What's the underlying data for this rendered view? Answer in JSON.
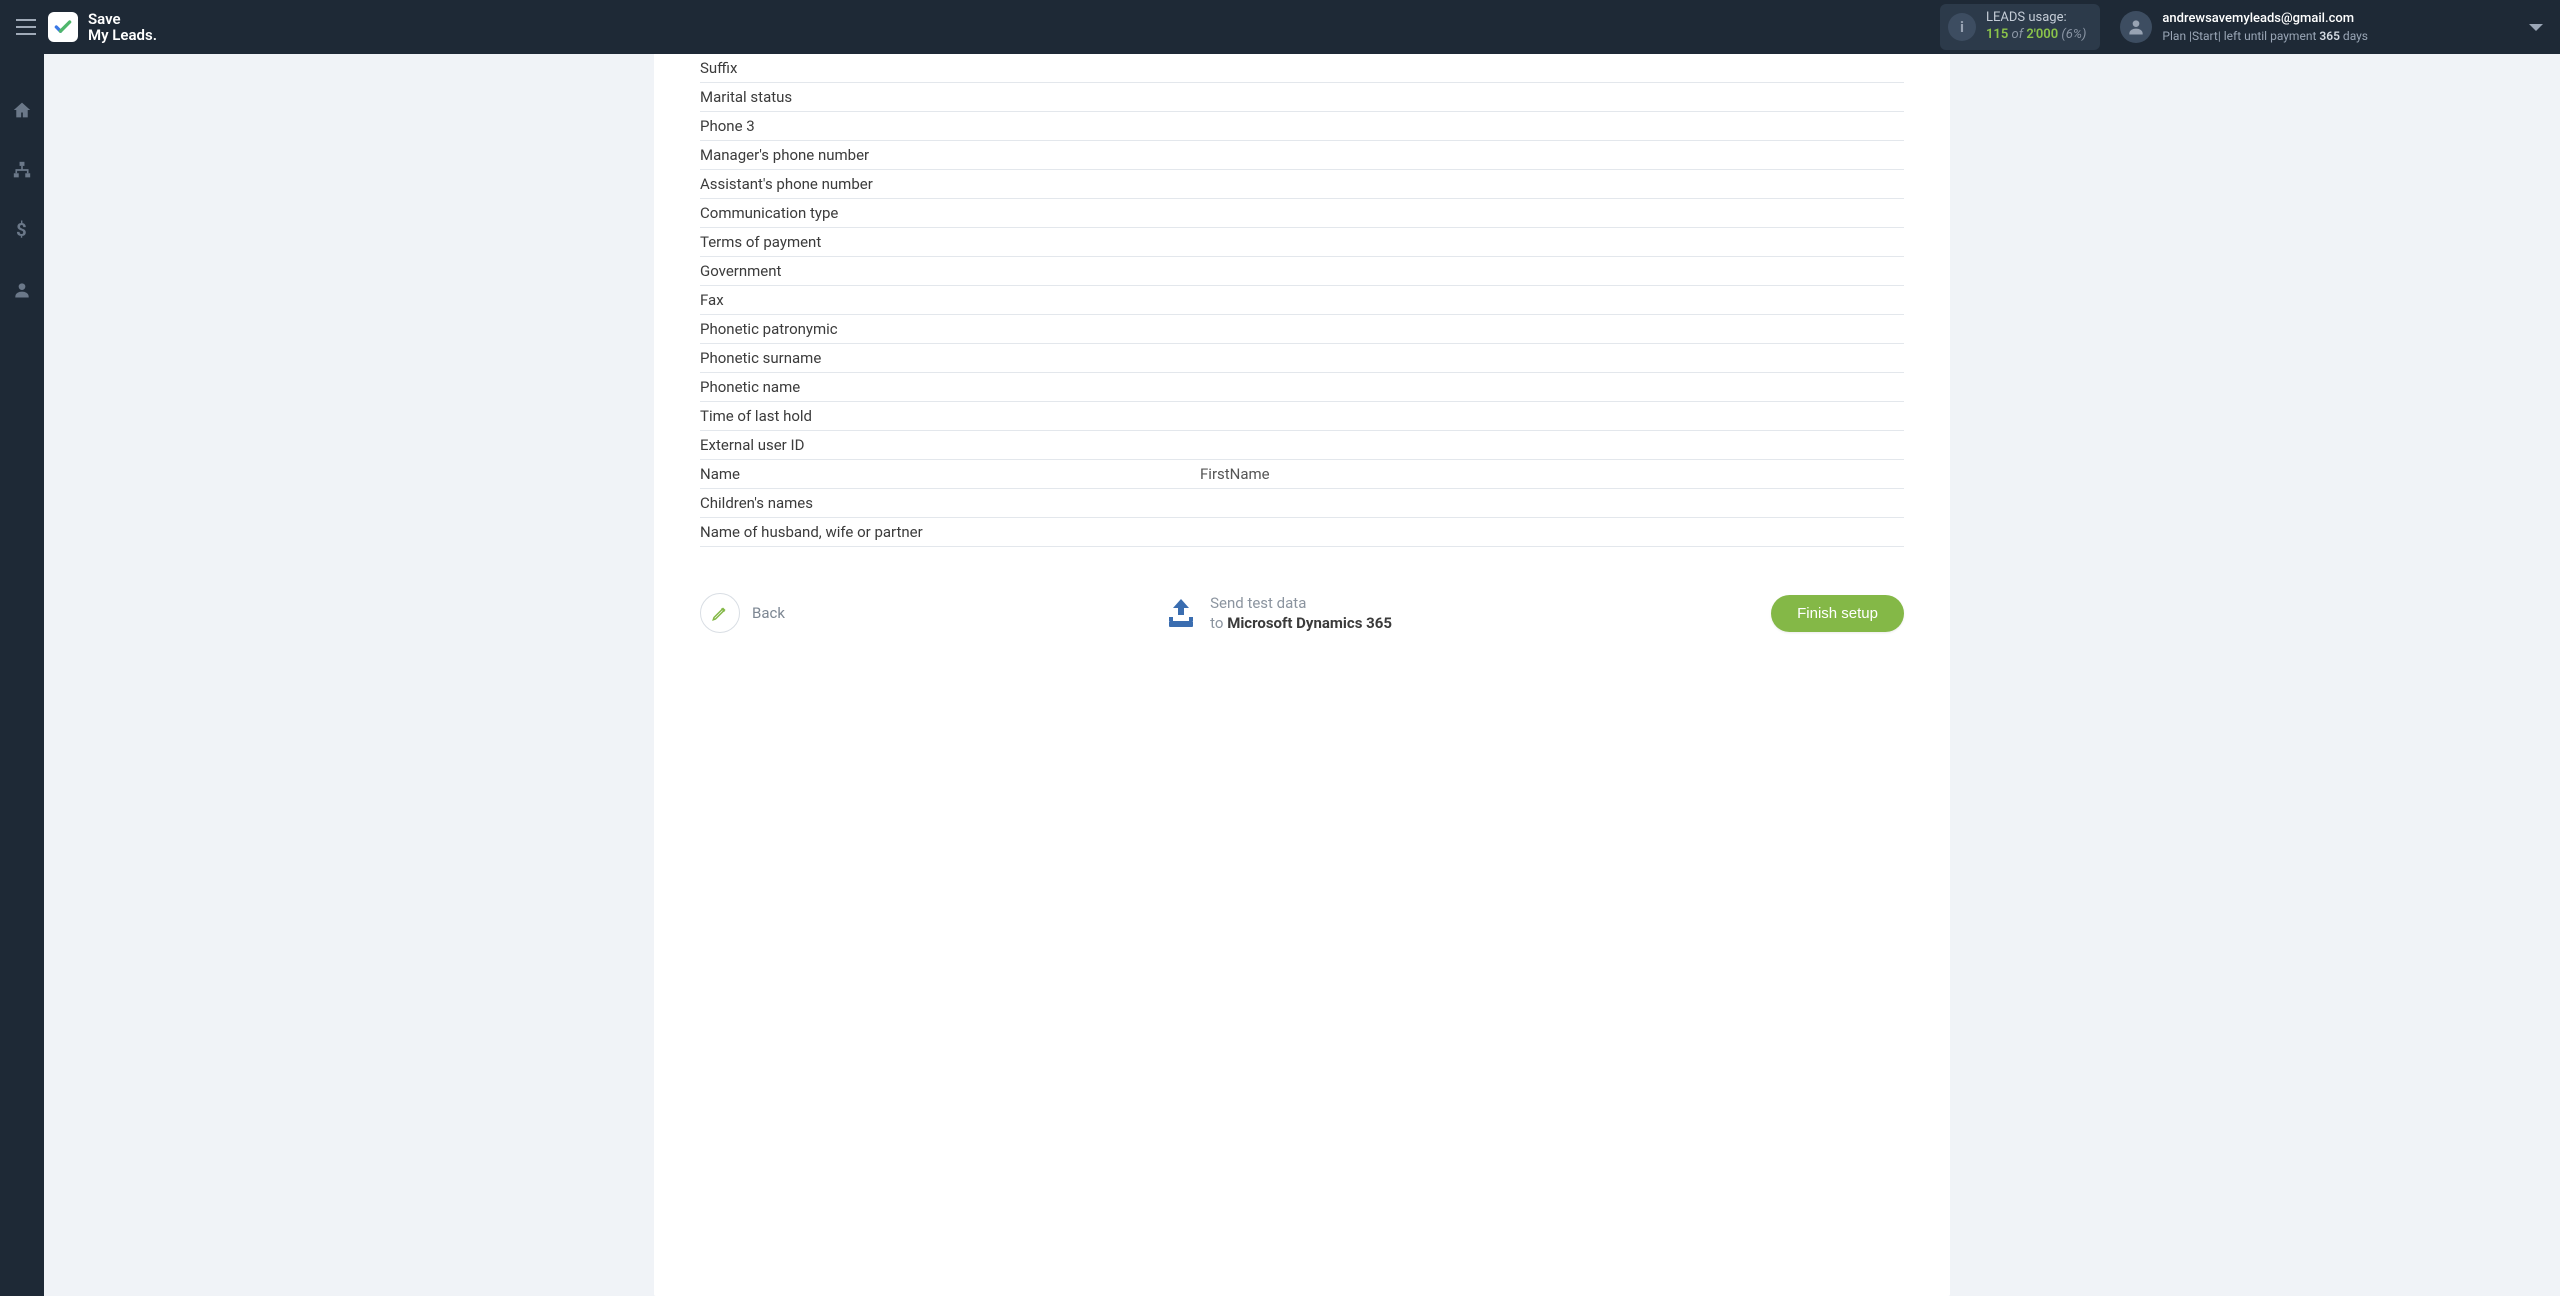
{
  "header": {
    "logo_line1": "Save",
    "logo_line2": "My Leads.",
    "usage": {
      "label": "LEADS usage:",
      "value": "115",
      "of": "of",
      "max": "2'000",
      "pct": "(6%)"
    },
    "account": {
      "email": "andrewsavemyleads@gmail.com",
      "plan_prefix": "Plan |Start| left until payment",
      "plan_days": "365",
      "plan_suffix": "days"
    }
  },
  "fields": [
    {
      "label": "Suffix",
      "value": ""
    },
    {
      "label": "Marital status",
      "value": ""
    },
    {
      "label": "Phone 3",
      "value": ""
    },
    {
      "label": "Manager's phone number",
      "value": ""
    },
    {
      "label": "Assistant's phone number",
      "value": ""
    },
    {
      "label": "Communication type",
      "value": ""
    },
    {
      "label": "Terms of payment",
      "value": ""
    },
    {
      "label": "Government",
      "value": ""
    },
    {
      "label": "Fax",
      "value": ""
    },
    {
      "label": "Phonetic patronymic",
      "value": ""
    },
    {
      "label": "Phonetic surname",
      "value": ""
    },
    {
      "label": "Phonetic name",
      "value": ""
    },
    {
      "label": "Time of last hold",
      "value": ""
    },
    {
      "label": "External user ID",
      "value": ""
    },
    {
      "label": "Name",
      "value": "FirstName"
    },
    {
      "label": "Children's names",
      "value": ""
    },
    {
      "label": "Name of husband, wife or partner",
      "value": ""
    }
  ],
  "actions": {
    "back": "Back",
    "send_line1": "Send test data",
    "send_to": "to",
    "send_dest": "Microsoft Dynamics 365",
    "finish": "Finish setup"
  }
}
